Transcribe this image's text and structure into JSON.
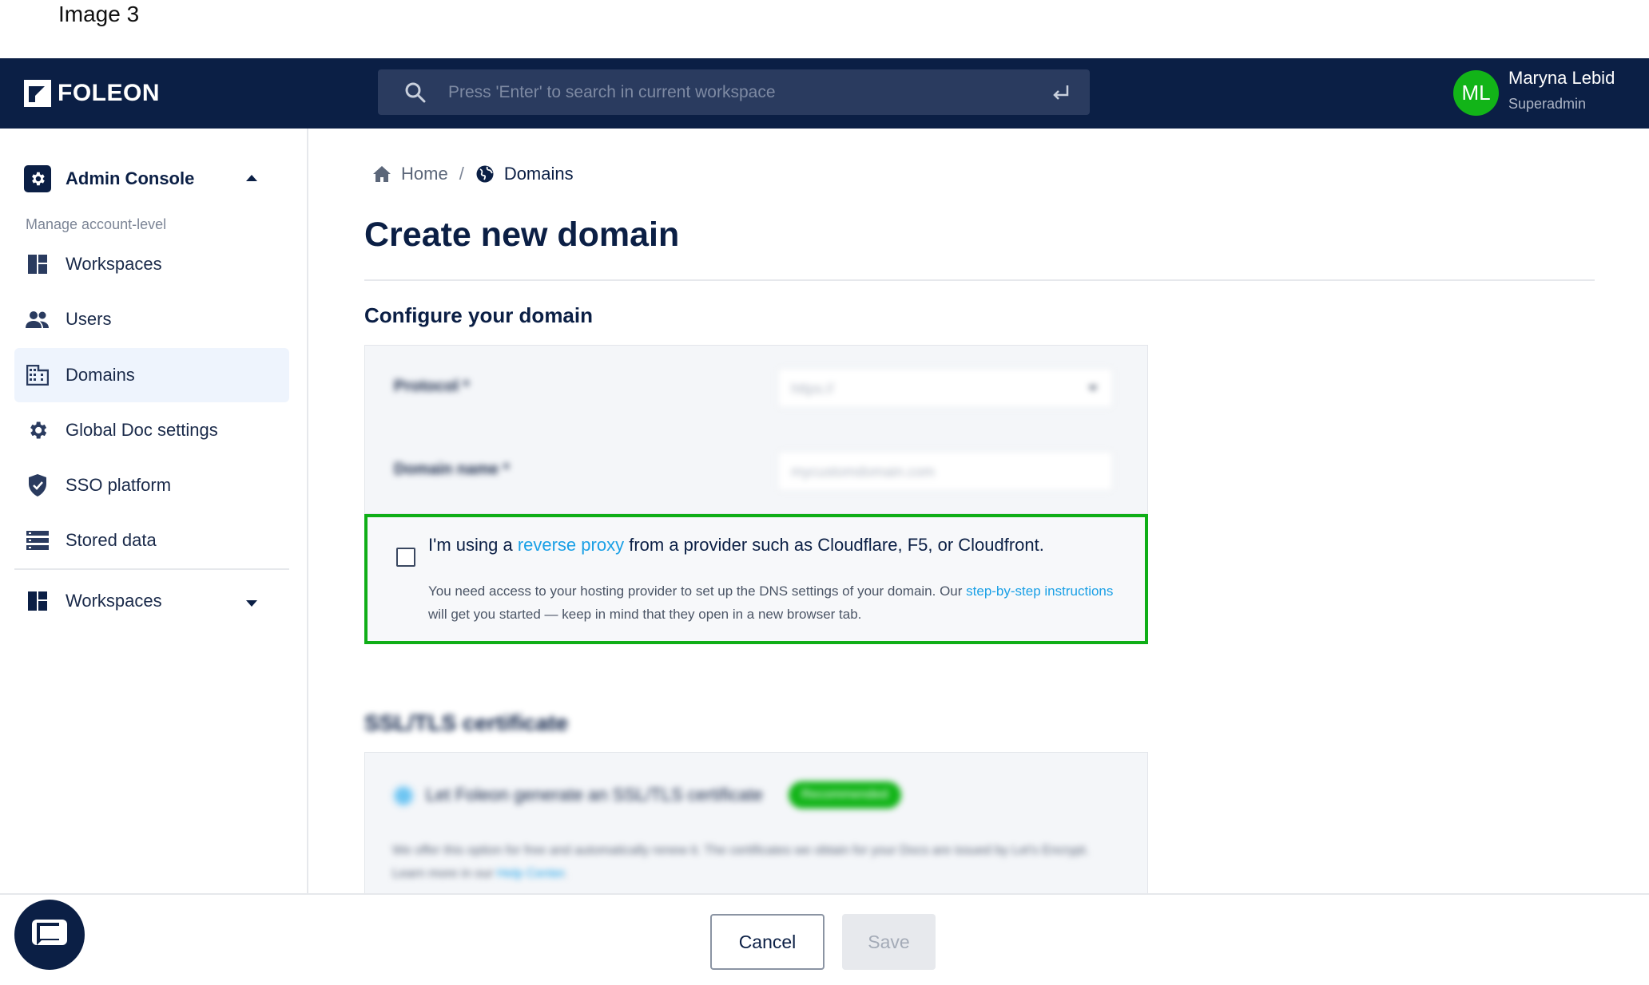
{
  "caption": "Image 3",
  "header": {
    "logo_text": "FOLEON",
    "search_placeholder": "Press 'Enter' to search in current workspace",
    "user": {
      "initials": "ML",
      "name": "Maryna Lebid",
      "role": "Superadmin"
    }
  },
  "sidebar": {
    "console_title": "Admin Console",
    "caption": "Manage account-level",
    "items": [
      {
        "label": "Workspaces",
        "icon": "dashboard-icon"
      },
      {
        "label": "Users",
        "icon": "users-icon"
      },
      {
        "label": "Domains",
        "icon": "building-icon",
        "active": true
      },
      {
        "label": "Global Doc settings",
        "icon": "gear-icon"
      },
      {
        "label": "SSO platform",
        "icon": "shield-check-icon"
      },
      {
        "label": "Stored data",
        "icon": "storage-icon"
      }
    ],
    "workspaces_dropdown": "Workspaces"
  },
  "breadcrumb": {
    "home": "Home",
    "separator": "/",
    "current": "Domains"
  },
  "page": {
    "title": "Create new domain",
    "section_title": "Configure your domain",
    "protocol_label": "Protocol *",
    "protocol_value": "https://",
    "domain_label": "Domain name *",
    "domain_placeholder": "mycustomdomain.com",
    "proxy": {
      "text_before": "I'm using a ",
      "link": "reverse proxy",
      "text_after": " from a provider such as Cloudflare, F5, or Cloudfront.",
      "help_before": "You need access to your hosting provider to set up the DNS settings of your domain. Our ",
      "help_link": "step-by-step instructions",
      "help_after": " will get you started — keep in mind that they open in a new browser tab."
    },
    "ssl": {
      "title": "SSL/TLS certificate",
      "option": "Let Foleon generate an SSL/TLS certificate",
      "badge": "Recommended",
      "desc_before": "We offer this option for free and automatically renew it. The certificates we obtain for your Docs are issued by Let's Encrypt. Learn more in our ",
      "desc_link": "Help Center",
      "desc_after": "."
    }
  },
  "footer": {
    "cancel_label": "Cancel",
    "save_label": "Save"
  },
  "colors": {
    "navy": "#0b1f45",
    "accent_green": "#0fae17",
    "link_blue": "#1aa0e6",
    "active_bg": "#eef4fd"
  }
}
